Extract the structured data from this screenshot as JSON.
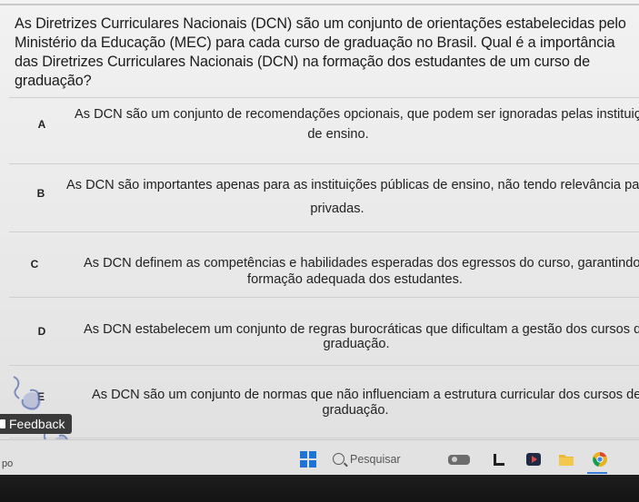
{
  "question": {
    "text": "As Diretrizes Curriculares Nacionais (DCN) são um conjunto de orientações estabelecidas pelo Ministério da Educação (MEC) para cada curso de graduação no Brasil. Qual é a importância das Diretrizes Curriculares Nacionais (DCN) na formação dos estudantes de um curso de graduação?"
  },
  "options": [
    {
      "letter": "A",
      "line1": "As DCN são um conjunto de recomendações opcionais, que podem ser ignoradas pelas instituições",
      "line2": "de ensino."
    },
    {
      "letter": "B",
      "line1": "As DCN são importantes apenas para as instituições públicas de ensino, não tendo relevância para as",
      "line2": "privadas."
    },
    {
      "letter": "C",
      "line1": "As DCN definem as competências e habilidades esperadas dos egressos do curso, garantindo a",
      "line2": "formação adequada dos estudantes."
    },
    {
      "letter": "D",
      "line1": "As DCN estabelecem um conjunto de regras burocráticas que dificultam a gestão dos cursos de",
      "line2": "graduação."
    },
    {
      "letter": "E",
      "line1": "As DCN são um conjunto de normas que não influenciam a estrutura curricular dos cursos de",
      "line2": "graduação."
    }
  ],
  "feedback": {
    "label": "Feedback"
  },
  "taskbar": {
    "left_text": "po",
    "search_placeholder": "Pesquisar",
    "icons": [
      "start-icon",
      "search-icon",
      "widget-icon",
      "file-explorer-icon",
      "media-icon",
      "folder-icon",
      "chrome-icon"
    ]
  },
  "colors": {
    "text": "#222222",
    "feedback_bg": "#3a3a3a",
    "start_blue": "#1e73d6"
  }
}
